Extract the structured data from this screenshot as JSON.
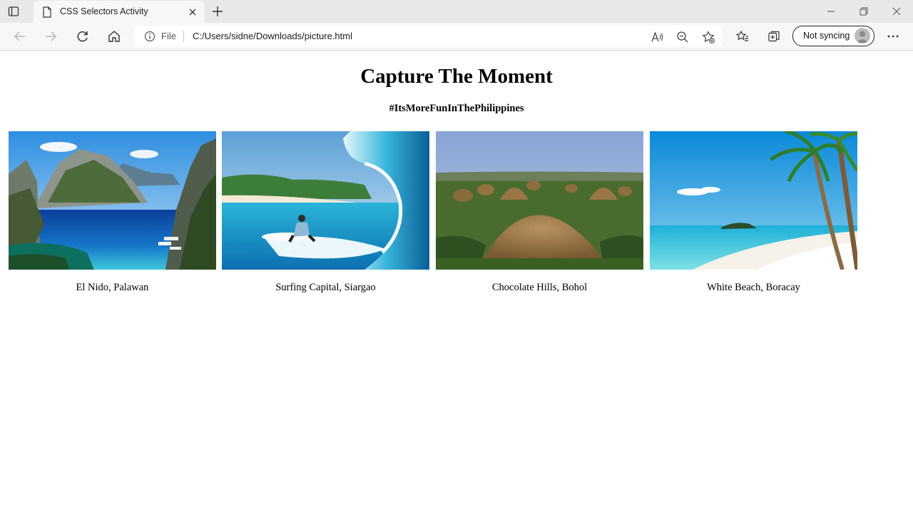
{
  "browser": {
    "tab_title": "CSS Selectors Activity",
    "address_scheme": "File",
    "address_url": "C:/Users/sidne/Downloads/picture.html",
    "profile_label": "Not syncing",
    "icons": [
      "tab-actions-icon",
      "page-icon",
      "close-icon",
      "plus-icon",
      "minimize-icon",
      "restore-icon",
      "window-close-icon",
      "back-icon",
      "forward-icon",
      "refresh-icon",
      "home-icon",
      "info-icon",
      "read-aloud-icon",
      "zoom-out-icon",
      "add-favorite-icon",
      "favorites-icon",
      "collections-icon",
      "avatar-icon",
      "more-icon"
    ]
  },
  "page": {
    "heading": "Capture The Moment",
    "hashtag": "#ItsMoreFunInThePhilippines",
    "cards": [
      {
        "caption": "El Nido, Palawan"
      },
      {
        "caption": "Surfing Capital, Siargao"
      },
      {
        "caption": "Chocolate Hills, Bohol"
      },
      {
        "caption": "White Beach, Boracay"
      }
    ]
  }
}
